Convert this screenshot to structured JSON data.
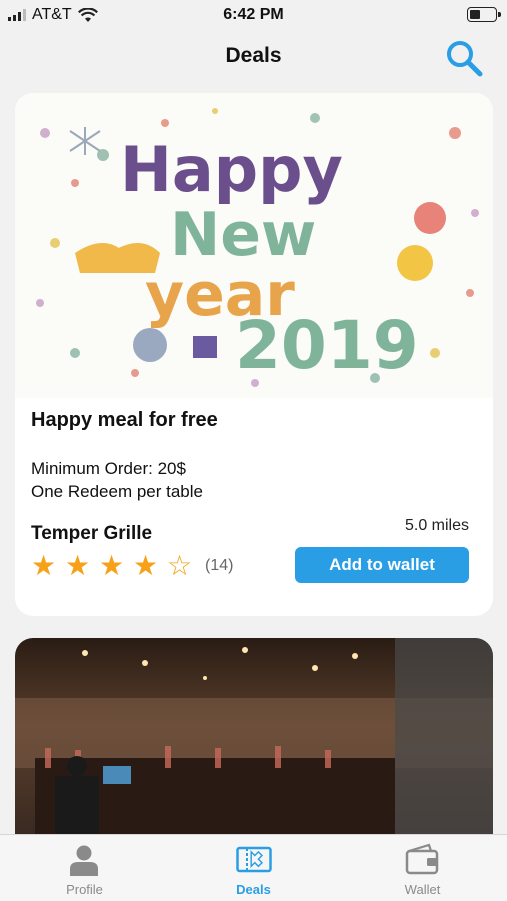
{
  "status_bar": {
    "carrier": "AT&T",
    "time": "6:42 PM",
    "battery_level": 0.4
  },
  "header": {
    "title": "Deals",
    "search_icon": "magnifier-icon"
  },
  "deal": {
    "banner_text": [
      "Happy",
      "New",
      "year",
      "2019"
    ],
    "title": "Happy meal for free",
    "details": [
      "Minimum Order: 20$",
      "One Redeem per table"
    ],
    "restaurant": "Temper Grille",
    "distance": "5.0 miles",
    "rating": 4,
    "rating_max": 5,
    "review_count": "(14)",
    "add_button": "Add to wallet"
  },
  "second_deal": {
    "image": "restaurant-bar-interior-photo"
  },
  "tabs": [
    {
      "label": "Profile",
      "icon": "person-icon",
      "active": false
    },
    {
      "label": "Deals",
      "icon": "coupon-ticket-icon",
      "active": true
    },
    {
      "label": "Wallet",
      "icon": "wallet-icon",
      "active": false
    }
  ],
  "colors": {
    "accent": "#2a9ee4",
    "star": "#f6a117",
    "inactive": "#8a8a8a"
  }
}
